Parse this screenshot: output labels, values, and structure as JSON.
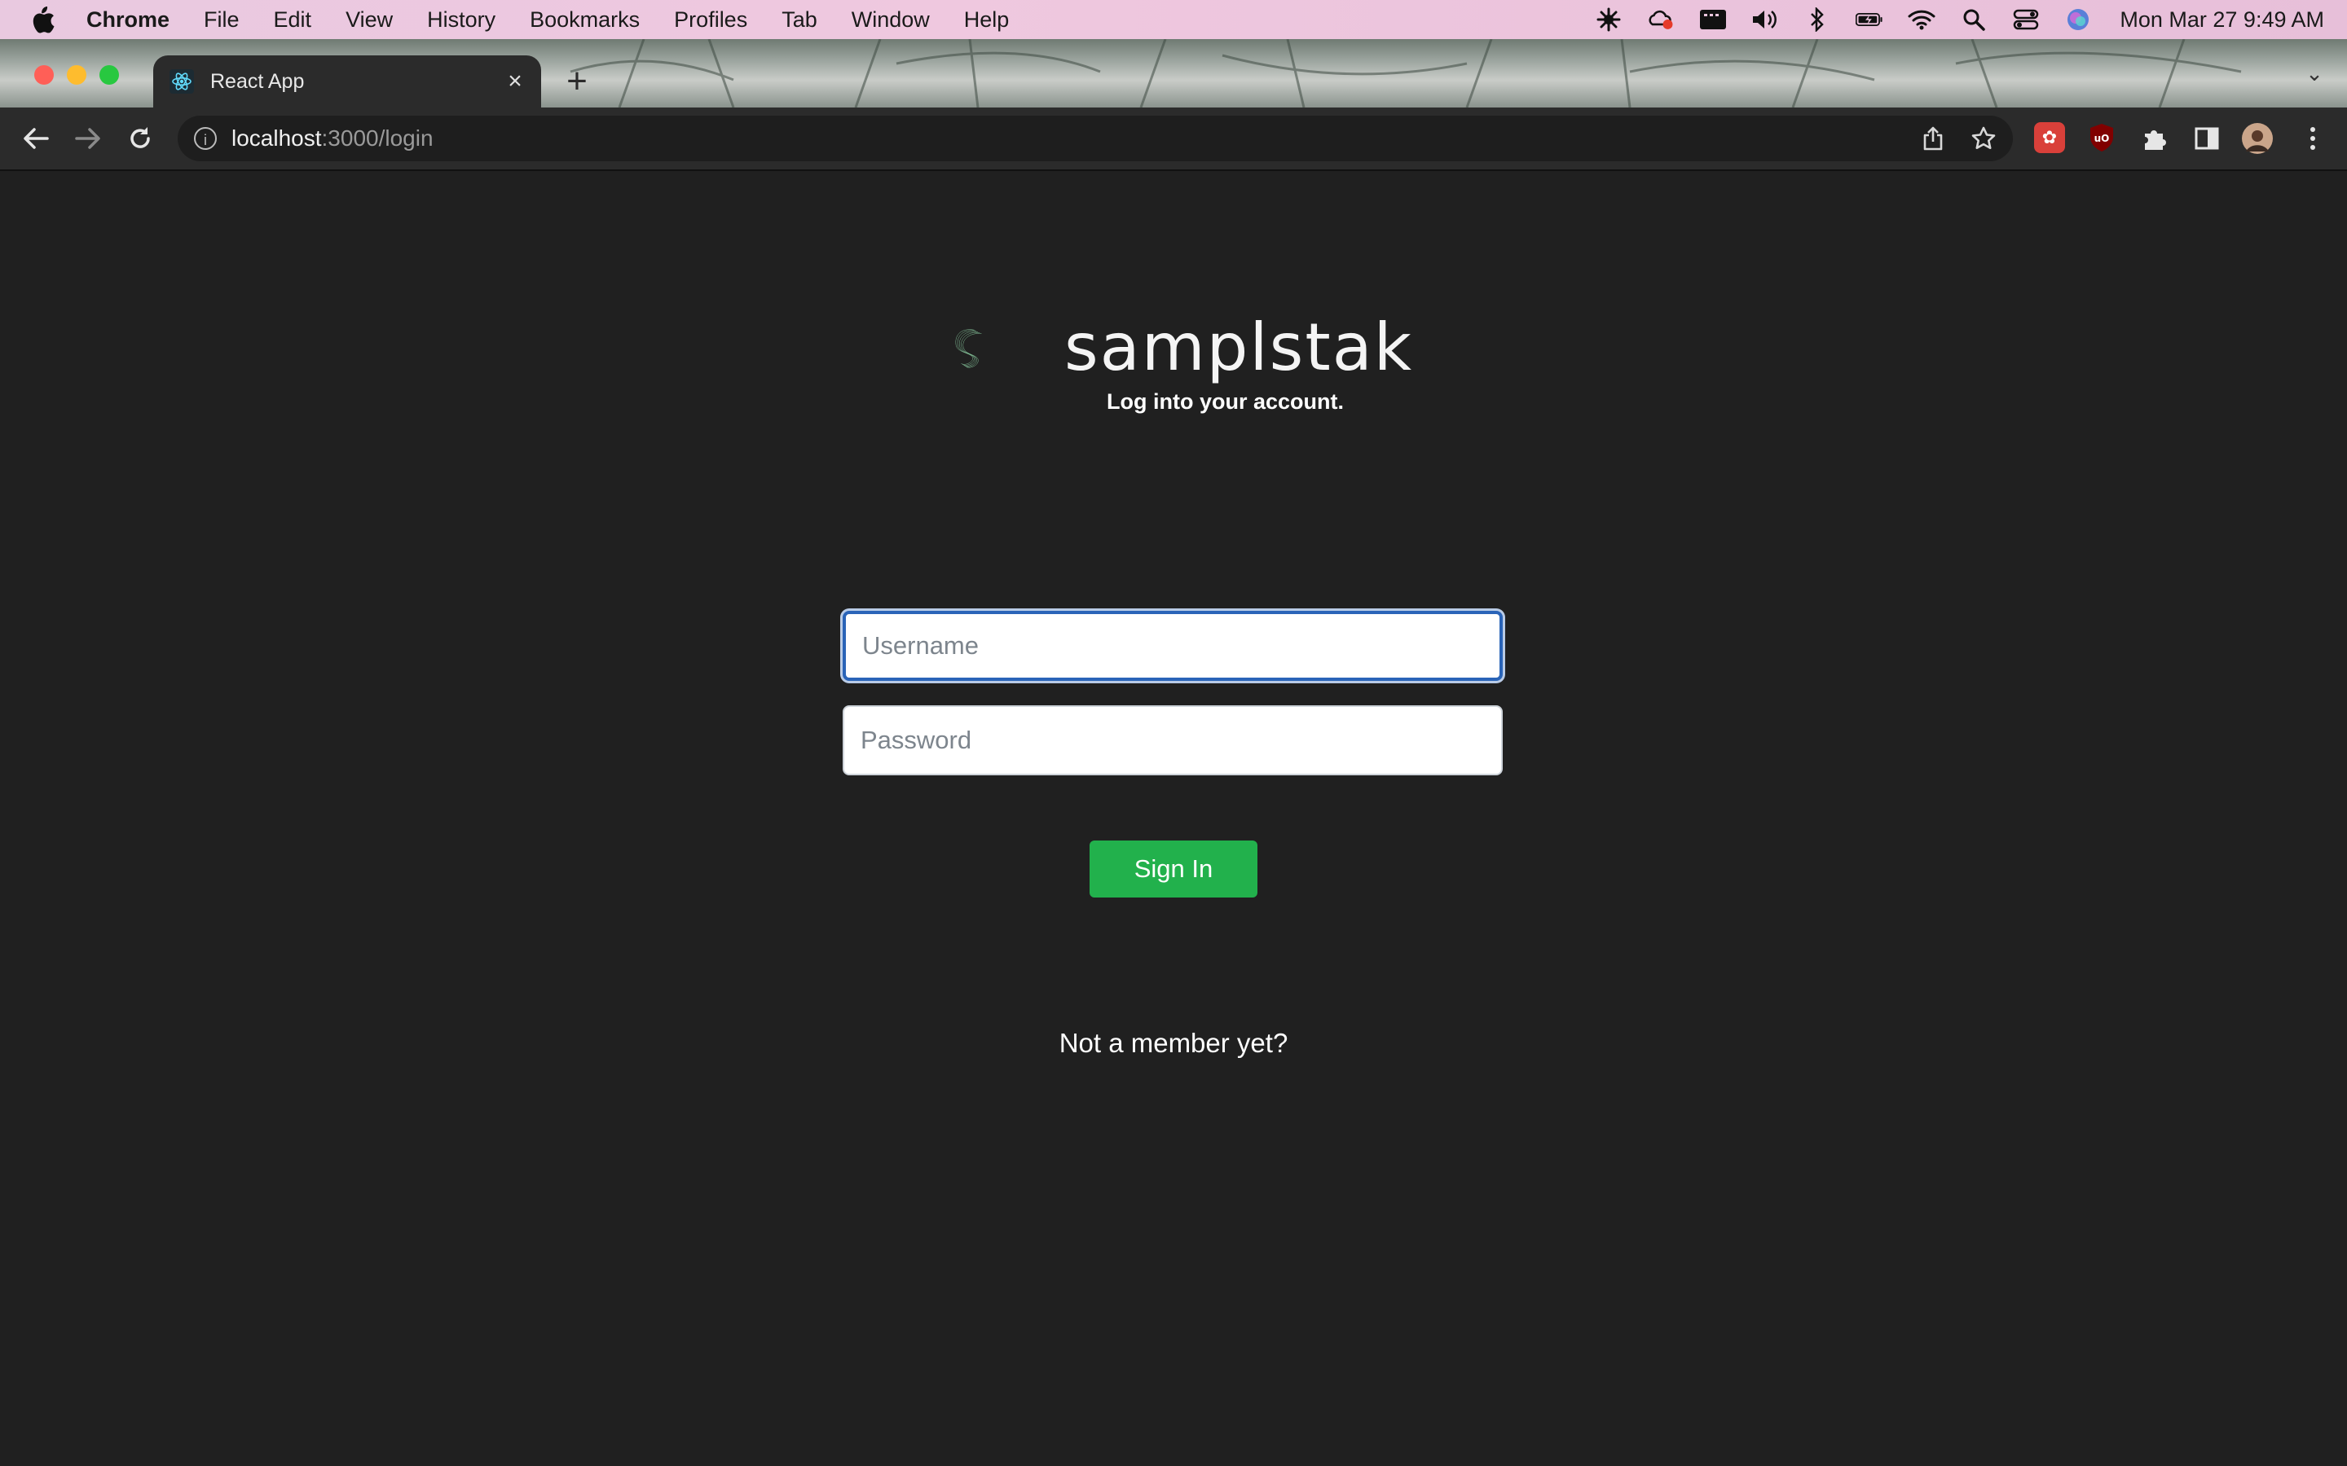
{
  "menubar": {
    "app": "Chrome",
    "menus": [
      "File",
      "Edit",
      "View",
      "History",
      "Bookmarks",
      "Profiles",
      "Tab",
      "Window",
      "Help"
    ],
    "clock": "Mon Mar 27  9:49 AM",
    "status_icons": [
      "burst-icon",
      "creative-cloud-icon",
      "screen-recorder-icon",
      "volume-icon",
      "bluetooth-icon",
      "battery-icon",
      "wifi-icon",
      "spotlight-icon",
      "control-center-icon",
      "siri-icon"
    ]
  },
  "browser": {
    "tab_title": "React App",
    "url_host": "localhost",
    "url_path": ":3000/login"
  },
  "login": {
    "brand": "samplstak",
    "tagline": "Log into your account.",
    "username_placeholder": "Username",
    "password_placeholder": "Password",
    "signin_label": "Sign In",
    "signup_prompt": "Not a member yet?"
  },
  "colors": {
    "page_bg": "#202020",
    "signin_button": "#22b14c",
    "focus_ring": "#2a64b8",
    "logo_stroke": "#8fd3a6"
  }
}
